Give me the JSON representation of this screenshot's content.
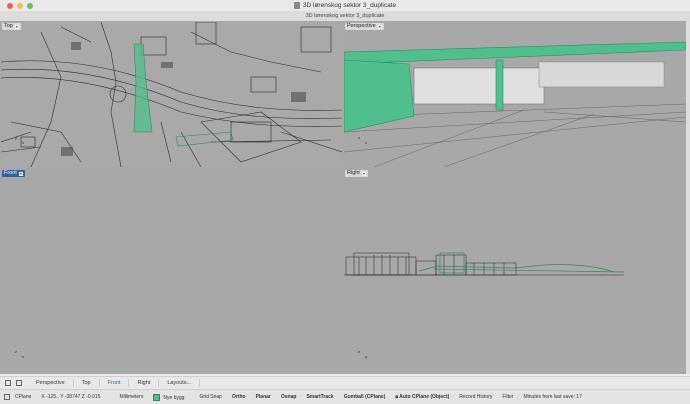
{
  "window": {
    "title": "3D lørenskog sektor 3_duplicate",
    "tab_title": "3D lørenskog sektor 3_duplicate"
  },
  "viewports": {
    "top": {
      "label": "Top"
    },
    "perspective": {
      "label": "Perspective"
    },
    "front": {
      "label": "Front"
    },
    "right": {
      "label": "Right"
    },
    "axis_x": "x",
    "axis_y": "y",
    "axis_z": "z"
  },
  "view_tabs": [
    "Perspective",
    "Top",
    "Front",
    "Right",
    "Layouts..."
  ],
  "status": {
    "cplane": "CPlane",
    "coords": "X -125..  Y -38747  Z -0.015",
    "units": "Millimeters",
    "layer": "Nye bygg",
    "grid_snap": "Grid Snap",
    "ortho": "Ortho",
    "planar": "Planar",
    "osnap": "Osnap",
    "smarttrack": "SmartTrack",
    "gumball": "Gumball (CPlane)",
    "auto_cplane": "Auto CPlane (Object)",
    "record_history": "Record History",
    "filter": "Filter",
    "minutes": "Minutes from last save: 17"
  },
  "colors": {
    "accent": "#2f62a8",
    "model_green": "#4fc08d",
    "viewport_bg": "#a4a4a4"
  }
}
